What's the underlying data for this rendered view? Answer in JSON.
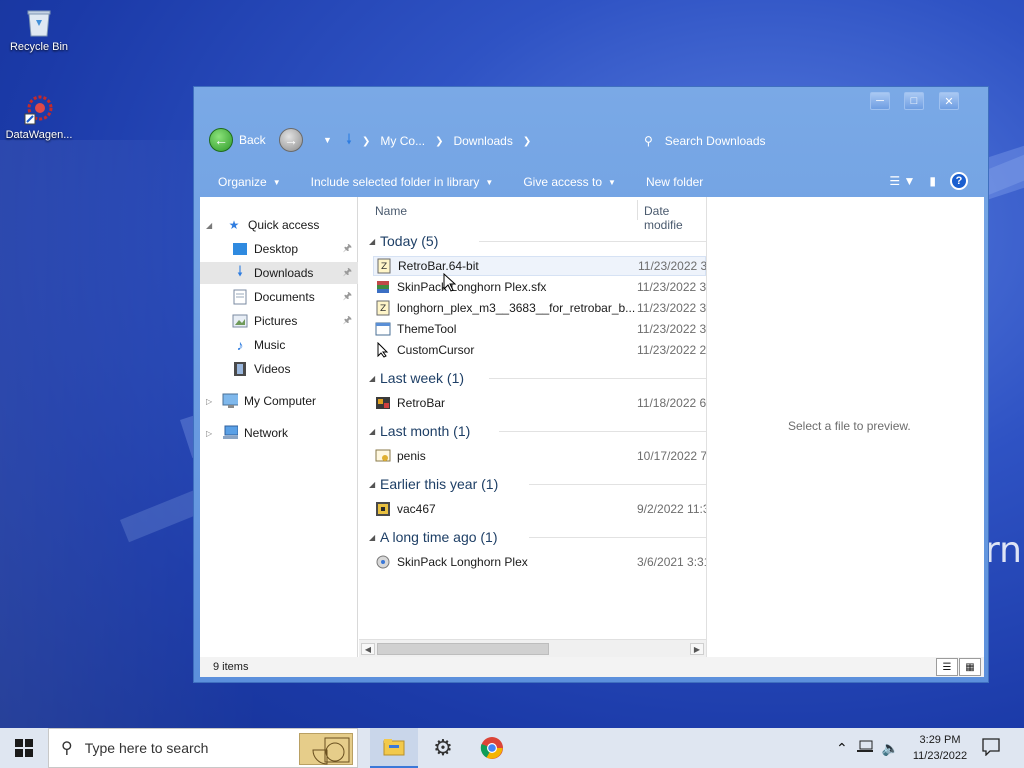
{
  "desktop": {
    "icons": [
      {
        "name": "recycle-bin",
        "label": "Recycle Bin"
      },
      {
        "name": "datawagen",
        "label": "DataWagen..."
      }
    ],
    "bg_text": "rn"
  },
  "window": {
    "nav": {
      "back_label": "Back",
      "breadcrumb": [
        "My Co...",
        "Downloads"
      ],
      "search_placeholder": "Search Downloads"
    },
    "toolbar": {
      "organize": "Organize",
      "include_folder": "Include selected folder in library",
      "give_access": "Give access to",
      "new_folder": "New folder"
    },
    "navpane": {
      "quick_access": "Quick access",
      "items": [
        {
          "label": "Desktop",
          "pinned": true
        },
        {
          "label": "Downloads",
          "pinned": true,
          "selected": true
        },
        {
          "label": "Documents",
          "pinned": true
        },
        {
          "label": "Pictures",
          "pinned": true
        },
        {
          "label": "Music",
          "pinned": false
        },
        {
          "label": "Videos",
          "pinned": false
        }
      ],
      "my_computer": "My Computer",
      "network": "Network"
    },
    "columns": {
      "name": "Name",
      "date": "Date modifie"
    },
    "groups": [
      {
        "title": "Today (5)",
        "files": [
          {
            "name": "RetroBar.64-bit",
            "date": "11/23/2022 3:",
            "icon": "zip-icon"
          },
          {
            "name": "SkinPack Longhorn Plex.sfx",
            "date": "11/23/2022 3:",
            "icon": "archive-icon"
          },
          {
            "name": "longhorn_plex_m3__3683__for_retrobar_b...",
            "date": "11/23/2022 3:",
            "icon": "zip-icon"
          },
          {
            "name": "ThemeTool",
            "date": "11/23/2022 3:",
            "icon": "app-window-icon"
          },
          {
            "name": "CustomCursor",
            "date": "11/23/2022 2:",
            "icon": "cursor-icon"
          }
        ]
      },
      {
        "title": "Last week (1)",
        "files": [
          {
            "name": "RetroBar",
            "date": "11/18/2022 6:",
            "icon": "app-icon"
          }
        ]
      },
      {
        "title": "Last month (1)",
        "files": [
          {
            "name": "penis",
            "date": "10/17/2022 7:",
            "icon": "certificate-icon"
          }
        ]
      },
      {
        "title": "Earlier this year (1)",
        "files": [
          {
            "name": "vac467",
            "date": "9/2/2022 11:3",
            "icon": "installer-icon"
          }
        ]
      },
      {
        "title": "A long time ago (1)",
        "files": [
          {
            "name": "SkinPack Longhorn Plex",
            "date": "3/6/2021 3:31",
            "icon": "setup-icon"
          }
        ]
      }
    ],
    "preview_text": "Select a file to preview.",
    "status": "9 items"
  },
  "taskbar": {
    "search_placeholder": "Type here to search",
    "time": "3:29 PM",
    "date": "11/23/2022"
  }
}
